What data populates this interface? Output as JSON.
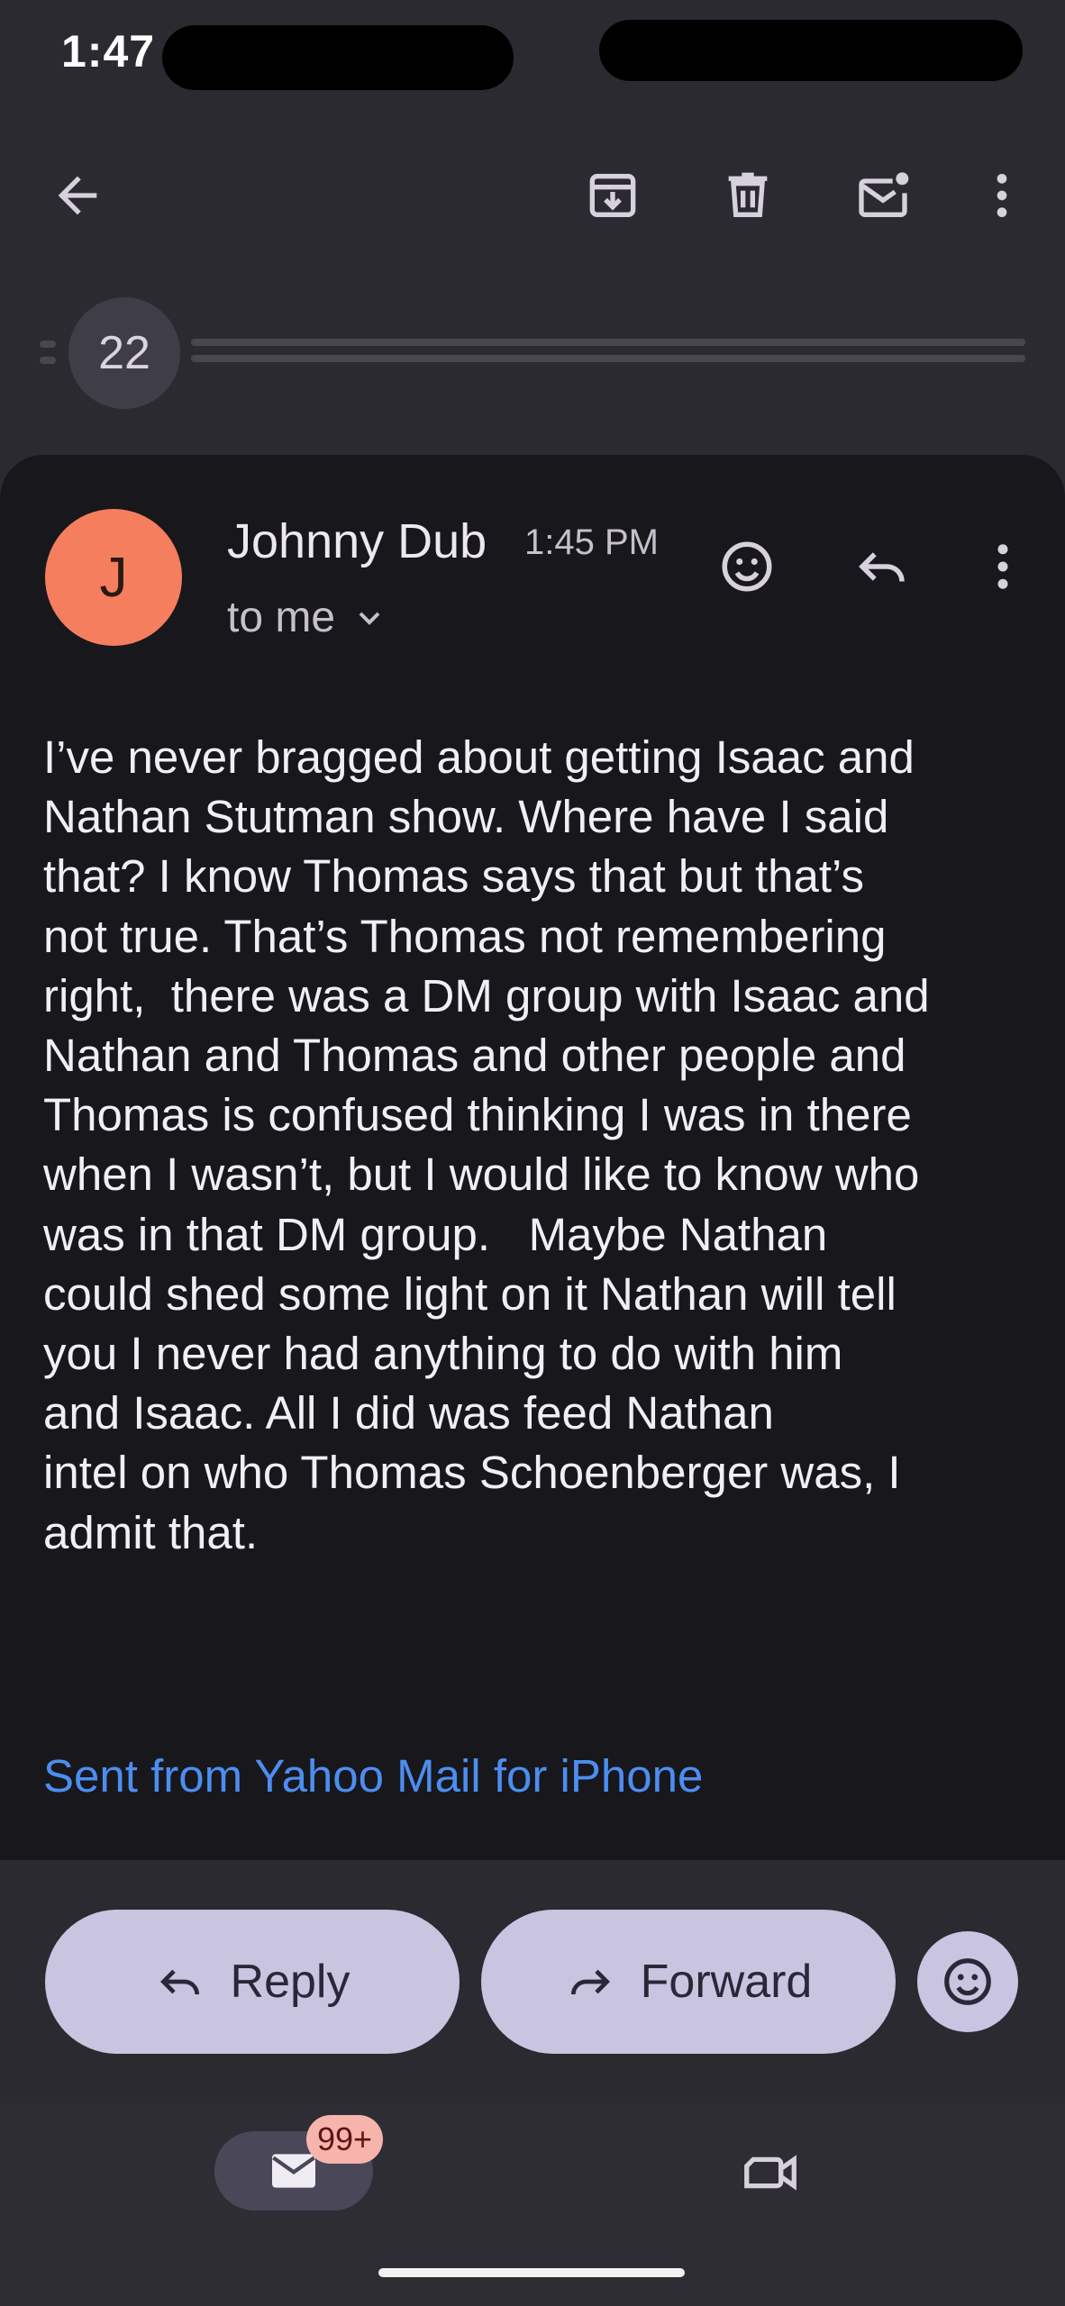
{
  "status_bar": {
    "time": "1:47"
  },
  "toolbar": {
    "back_icon": "arrow-left-icon",
    "archive_icon": "archive-icon",
    "delete_icon": "trash-icon",
    "mark_unread_icon": "mark-unread-icon",
    "more_icon": "more-vert-icon"
  },
  "thread": {
    "collapsed_count": "22"
  },
  "message": {
    "avatar_letter": "J",
    "sender": "Johnny Dub",
    "time": "1:45 PM",
    "recipient": "to me",
    "body": "I’ve never bragged about getting Isaac and\nNathan Stutman show. Where have I said\nthat? I know Thomas says that but that’s\nnot true. That’s Thomas not remembering\nright,  there was a DM group with Isaac and\nNathan and Thomas and other people and\nThomas is confused thinking I was in there\nwhen I wasn’t, but I would like to know who\nwas in that DM group.   Maybe Nathan\ncould shed some light on it Nathan will tell\nyou I never had anything to do with him\nand Isaac. All I did was feed Nathan\nintel on who Thomas Schoenberger was, I\nadmit that.",
    "signature": "Sent from Yahoo Mail for iPhone"
  },
  "actions": {
    "reply_label": "Reply",
    "forward_label": "Forward"
  },
  "bottom_nav": {
    "mail_badge": "99+"
  },
  "colors": {
    "accent_link": "#4c8ef0",
    "avatar": "#f47e5e",
    "pill": "#c9c4e0"
  }
}
